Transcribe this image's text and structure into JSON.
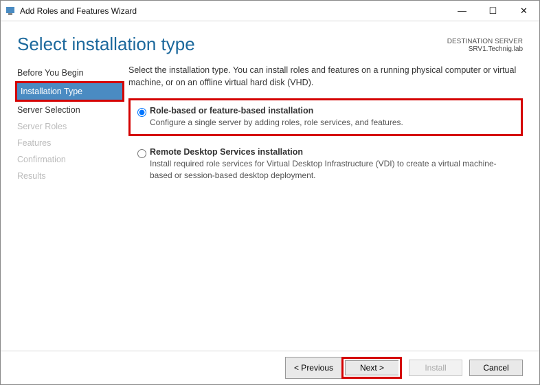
{
  "window": {
    "title": "Add Roles and Features Wizard"
  },
  "header": {
    "title": "Select installation type",
    "dest_label": "DESTINATION SERVER",
    "dest_name": "SRV1.Technig.lab"
  },
  "nav": {
    "items": [
      {
        "label": "Before You Begin",
        "state": "normal"
      },
      {
        "label": "Installation Type",
        "state": "active"
      },
      {
        "label": "Server Selection",
        "state": "normal"
      },
      {
        "label": "Server Roles",
        "state": "disabled"
      },
      {
        "label": "Features",
        "state": "disabled"
      },
      {
        "label": "Confirmation",
        "state": "disabled"
      },
      {
        "label": "Results",
        "state": "disabled"
      }
    ]
  },
  "main": {
    "intro": "Select the installation type. You can install roles and features on a running physical computer or virtual machine, or on an offline virtual hard disk (VHD).",
    "options": [
      {
        "title": "Role-based or feature-based installation",
        "desc": "Configure a single server by adding roles, role services, and features.",
        "selected": true
      },
      {
        "title": "Remote Desktop Services installation",
        "desc": "Install required role services for Virtual Desktop Infrastructure (VDI) to create a virtual machine-based or session-based desktop deployment.",
        "selected": false
      }
    ]
  },
  "footer": {
    "previous": "< Previous",
    "next": "Next >",
    "install": "Install",
    "cancel": "Cancel"
  }
}
